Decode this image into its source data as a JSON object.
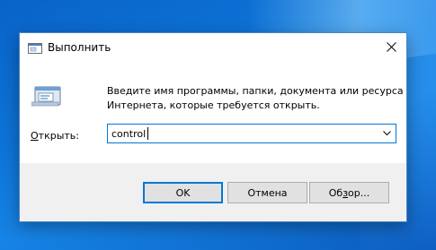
{
  "window": {
    "title": "Выполнить",
    "icon": "run-app-icon",
    "close_icon": "close-icon"
  },
  "content": {
    "description": "Введите имя программы, папки, документа или ресурса Интернета, которые требуется открыть.",
    "open_label_mnemonic": "О",
    "open_label_rest": "ткрыть:",
    "input_value": "control",
    "dropdown_icon": "chevron-down-icon"
  },
  "buttons": {
    "ok": "OK",
    "cancel": "Отмена",
    "browse_prefix": "Об",
    "browse_mnemonic": "з",
    "browse_suffix": "ор..."
  },
  "colors": {
    "accent": "#0078d7",
    "dialog_bg": "#f0f0f0",
    "desktop_bg": "#0d74d8"
  }
}
